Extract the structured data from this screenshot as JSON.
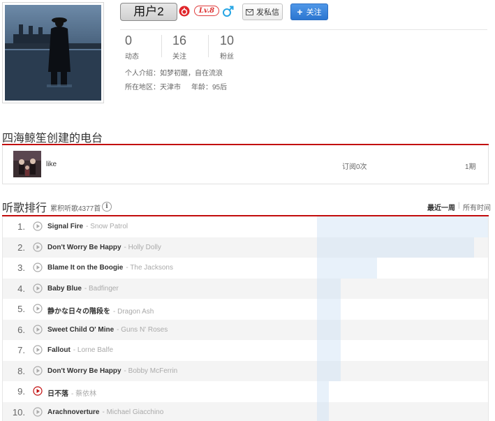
{
  "profile": {
    "username": "用户2",
    "level": "Lv.8",
    "gender": "male",
    "message_button": "发私信",
    "follow_button": "关注",
    "stats": [
      {
        "value": "0",
        "label": "动态"
      },
      {
        "value": "16",
        "label": "关注"
      },
      {
        "value": "10",
        "label": "粉丝"
      }
    ],
    "bio": "个人介绍：如梦初醒，自在流浪",
    "location": "所在地区：天津市",
    "age": "年龄：95后"
  },
  "radio": {
    "section_title": "四海鲸笙创建的电台",
    "name": "like",
    "subscriptions": "订阅0次",
    "episodes": "1期"
  },
  "ranking": {
    "title": "听歌排行",
    "total": "累积听歌4377首",
    "tab_week": "最近一周",
    "tab_separator": "|",
    "tab_all": "所有时间",
    "songs": [
      {
        "rank": "1.",
        "title": "Signal Fire",
        "artist": "Snow Patrol",
        "bar": 1.0
      },
      {
        "rank": "2.",
        "title": "Don't Worry Be Happy",
        "artist": "Holly Dolly",
        "bar": 0.92
      },
      {
        "rank": "3.",
        "title": "Blame It on the Boogie",
        "artist": "The Jacksons",
        "bar": 0.35
      },
      {
        "rank": "4.",
        "title": "Baby Blue",
        "artist": "Badfinger",
        "bar": 0.14
      },
      {
        "rank": "5.",
        "title": "静かな日々の階段を",
        "artist": "Dragon Ash",
        "bar": 0.14
      },
      {
        "rank": "6.",
        "title": "Sweet Child O' Mine",
        "artist": "Guns N' Roses",
        "bar": 0.14
      },
      {
        "rank": "7.",
        "title": "Fallout",
        "artist": "Lorne Balfe",
        "bar": 0.14
      },
      {
        "rank": "8.",
        "title": "Don't Worry Be Happy",
        "artist": "Bobby McFerrin",
        "bar": 0.14
      },
      {
        "rank": "9.",
        "title": "日不落",
        "artist": "蔡依林",
        "bar": 0.07,
        "playing": true
      },
      {
        "rank": "10.",
        "title": "Arachnoverture",
        "artist": "Michael Giacchino",
        "bar": 0.07
      }
    ]
  },
  "colors": {
    "accent_red": "#c20c0c",
    "follow_blue": "#2c76d0",
    "bar_blue": "#cde1f3"
  }
}
